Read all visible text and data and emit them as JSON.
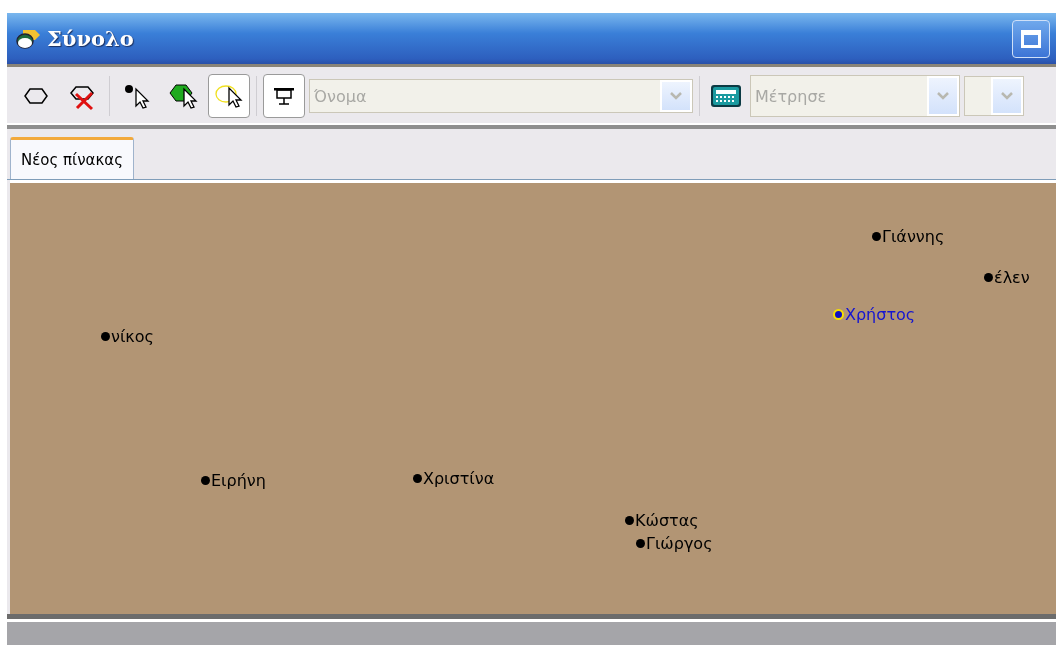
{
  "window": {
    "title": "Σύνολο"
  },
  "toolbar": {
    "tools": [
      {
        "kind": "ellipse",
        "selected": false
      },
      {
        "kind": "delete-ellipse",
        "selected": false
      },
      {
        "kind": "dot-pointer",
        "selected": false
      },
      {
        "kind": "fill-pointer",
        "selected": false
      },
      {
        "kind": "ring-pointer",
        "selected": true
      },
      {
        "kind": "screen",
        "selected": true
      }
    ],
    "name_combo": {
      "value": "Όνομα",
      "disabled": true
    },
    "measure_combo": {
      "value": "Μέτρησε",
      "disabled": true
    }
  },
  "tabs": [
    {
      "label": "Νέος πίνακας",
      "selected": true
    }
  ],
  "nodes": [
    {
      "label": "Γιάννης",
      "selected": false
    },
    {
      "label": "έλεν",
      "selected": false
    },
    {
      "label": "Χρήστος",
      "selected": true
    },
    {
      "label": "νίκος",
      "selected": false
    },
    {
      "label": "Ειρήνη",
      "selected": false
    },
    {
      "label": "Χριστίνα",
      "selected": false
    },
    {
      "label": "Κώστας",
      "selected": false
    },
    {
      "label": "Γιώργος",
      "selected": false
    }
  ]
}
